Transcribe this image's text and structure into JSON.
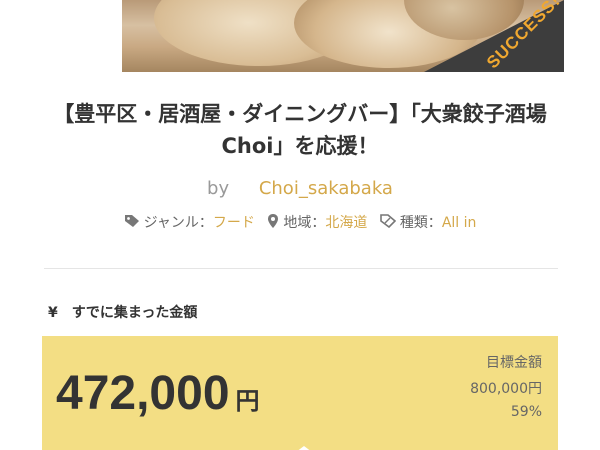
{
  "project": {
    "badge": "SUCCESS!",
    "title": "【豊平区・居酒屋・ダイニングバー】「大衆餃子酒場Choi」を応援！",
    "by_label": "by",
    "author": "Choi_sakabaka"
  },
  "meta": {
    "genre_label": "ジャンル：",
    "genre_value": "フード",
    "region_label": "地域：",
    "region_value": "北海道",
    "type_label": "種類：",
    "type_value": "All in"
  },
  "funding": {
    "raised_label": "¥　すでに集まった金額",
    "amount": "472,000",
    "unit": "円",
    "goal_label": "目標金額",
    "goal_amount": "800,000円",
    "percent": "59%"
  },
  "colors": {
    "accent": "#d4a84a",
    "badge_text": "#f0a830",
    "badge_bg": "#3d3d3d",
    "amount_box": "#f3de84"
  },
  "icons": [
    "tag-icon",
    "location-pin-icon",
    "type-tag-icon"
  ]
}
